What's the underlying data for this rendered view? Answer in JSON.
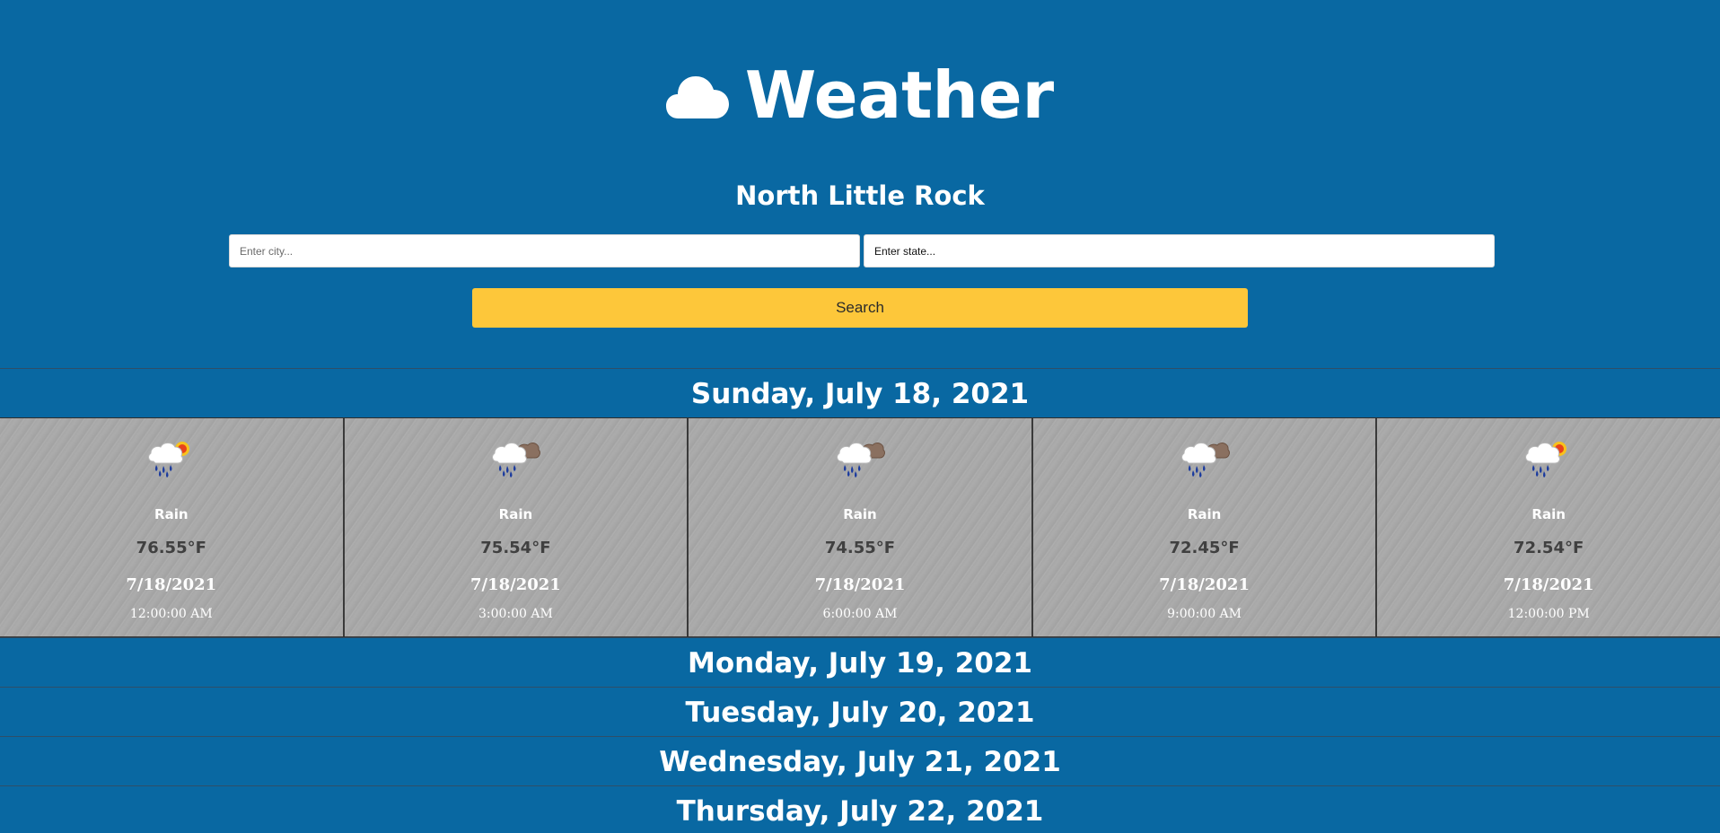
{
  "app": {
    "title": "Weather",
    "icon": "cloud-icon"
  },
  "location": {
    "city_name": "North Little Rock"
  },
  "search": {
    "city_placeholder": "Enter city...",
    "state_placeholder": "Enter state...",
    "button_label": "Search"
  },
  "days": [
    {
      "title": "Sunday, July 18, 2021",
      "expanded": true,
      "forecasts": [
        {
          "icon": "rain-sun-icon",
          "description": "Rain",
          "temperature": "76.55°F",
          "date": "7/18/2021",
          "time": "12:00:00 AM"
        },
        {
          "icon": "rain-cloud-icon",
          "description": "Rain",
          "temperature": "75.54°F",
          "date": "7/18/2021",
          "time": "3:00:00 AM"
        },
        {
          "icon": "rain-cloud-icon",
          "description": "Rain",
          "temperature": "74.55°F",
          "date": "7/18/2021",
          "time": "6:00:00 AM"
        },
        {
          "icon": "rain-cloud-icon",
          "description": "Rain",
          "temperature": "72.45°F",
          "date": "7/18/2021",
          "time": "9:00:00 AM"
        },
        {
          "icon": "rain-sun-icon",
          "description": "Rain",
          "temperature": "72.54°F",
          "date": "7/18/2021",
          "time": "12:00:00 PM"
        }
      ]
    },
    {
      "title": "Monday, July 19, 2021",
      "expanded": false
    },
    {
      "title": "Tuesday, July 20, 2021",
      "expanded": false
    },
    {
      "title": "Wednesday, July 21, 2021",
      "expanded": false
    },
    {
      "title": "Thursday, July 22, 2021",
      "expanded": false
    }
  ],
  "colors": {
    "background": "#0968a2",
    "search_button": "#fdc73a",
    "card": "#a7a7a7"
  }
}
